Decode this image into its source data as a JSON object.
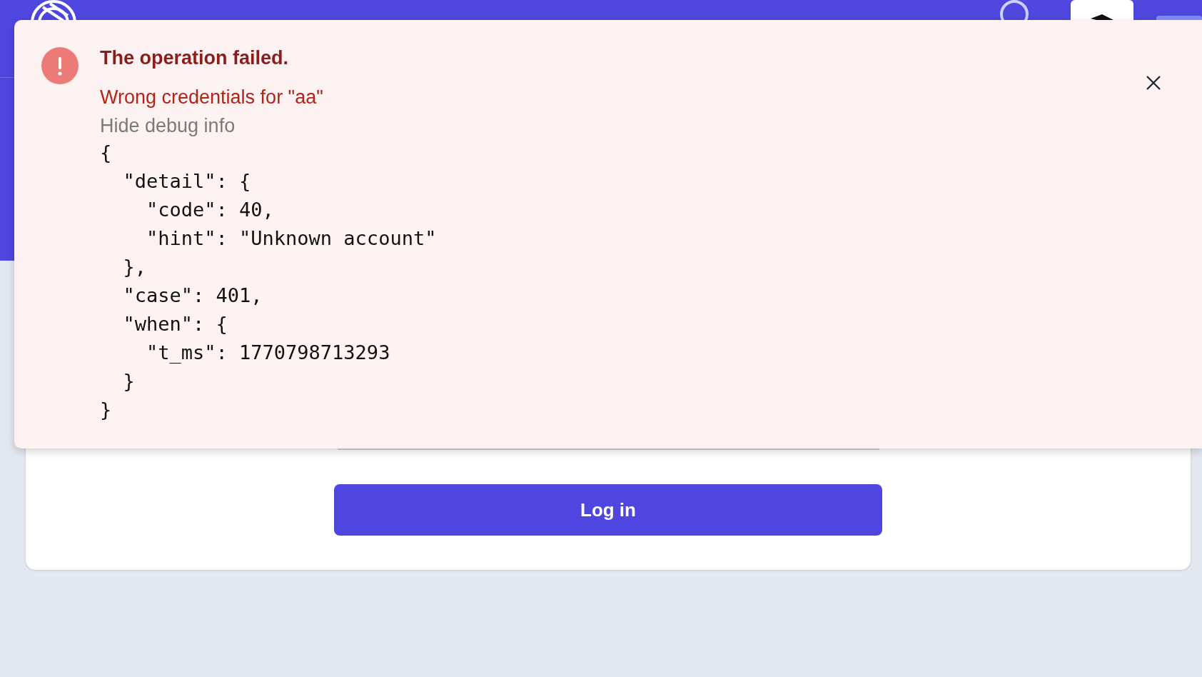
{
  "toast": {
    "title": "The operation failed.",
    "message": "Wrong credentials for \"aa\"",
    "debug_toggle": "Hide debug info",
    "debug_lines": [
      "{",
      "  \"detail\": {",
      "    \"code\": 40,",
      "    \"hint\": \"Unknown account\"",
      "  },",
      "  \"case\": 401,",
      "  \"when\": {",
      "    \"t_ms\": 1770798713293",
      "  }",
      "}"
    ]
  },
  "login_button": {
    "label": "Log in"
  }
}
